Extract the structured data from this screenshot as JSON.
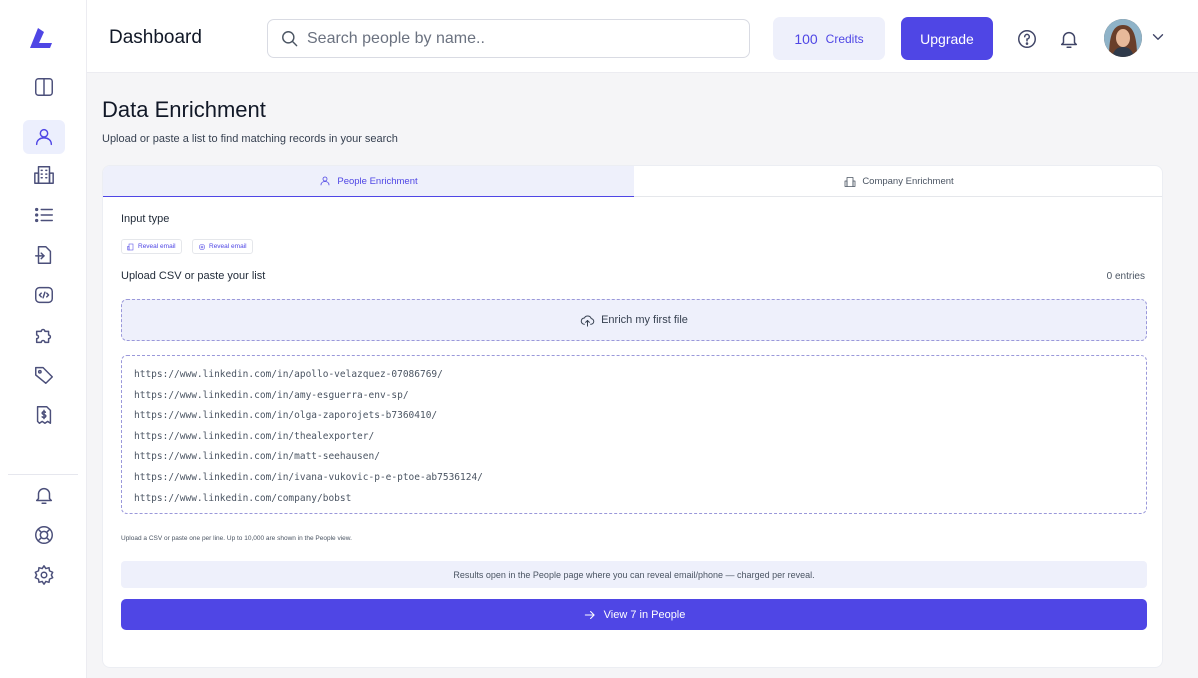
{
  "sidebar": {
    "logo": "brand-logo-icon",
    "items": [
      {
        "icon": "sidebar-panel-icon"
      },
      {
        "icon": "person-icon",
        "active": true
      },
      {
        "icon": "building-icon"
      },
      {
        "icon": "list-icon"
      },
      {
        "icon": "import-icon"
      },
      {
        "icon": "code-icon"
      },
      {
        "icon": "puzzle-icon"
      },
      {
        "icon": "tag-icon"
      },
      {
        "icon": "billing-icon"
      }
    ],
    "bottom_items": [
      {
        "icon": "bell-icon"
      },
      {
        "icon": "support-icon"
      },
      {
        "icon": "settings-icon"
      }
    ]
  },
  "header": {
    "title": "Dashboard",
    "search_placeholder": "Search people by name..",
    "credits_value": "100",
    "credits_label": "Credits",
    "upgrade_label": "Upgrade"
  },
  "page": {
    "heading": "Data Enrichment",
    "subheading": "Upload or paste a list to find matching records in your search",
    "tabs": [
      {
        "label": "People Enrichment",
        "active": true
      },
      {
        "label": "Company Enrichment",
        "active": false
      }
    ],
    "input_type_label": "Input type",
    "chips": [
      "Reveal email",
      "Reveal email"
    ],
    "upload_label": "Upload CSV or paste your list",
    "entries": "0 entries",
    "upload_button": "Enrich my first file",
    "list_lines": [
      "https://www.linkedin.com/in/apollo-velazquez-07086769/",
      "https://www.linkedin.com/in/amy-esguerra-env-sp/",
      "https://www.linkedin.com/in/olga-zaporojets-b7360410/",
      "https://www.linkedin.com/in/thealexporter/",
      "https://www.linkedin.com/in/matt-seehausen/",
      "https://www.linkedin.com/in/ivana-vukovic-p-e-ptoe-ab7536124/",
      "https://www.linkedin.com/company/bobst"
    ],
    "hint": "Upload a CSV or paste one per line. Up to 10,000 are shown in the People view.",
    "info": "Results open in the People page where you can reveal email/phone — charged per reveal.",
    "view_button": "View 7 in People"
  },
  "colors": {
    "accent": "#4f46e5",
    "accent_light": "#eef0fb",
    "background": "#f5f5f7"
  }
}
